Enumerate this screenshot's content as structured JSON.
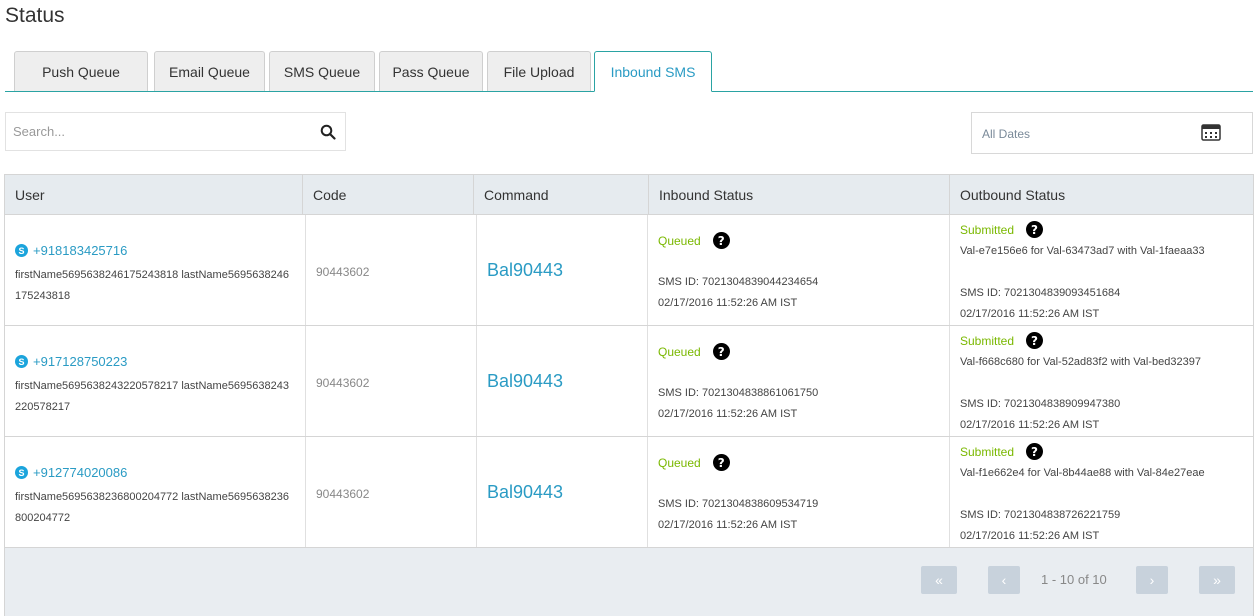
{
  "page": {
    "title": "Status"
  },
  "tabs": [
    {
      "label": "Push Queue"
    },
    {
      "label": "Email Queue"
    },
    {
      "label": "SMS Queue"
    },
    {
      "label": "Pass Queue"
    },
    {
      "label": "File Upload"
    },
    {
      "label": "Inbound SMS",
      "active": true
    }
  ],
  "search": {
    "placeholder": "Search...",
    "value": "",
    "icon": "search-icon"
  },
  "date_filter": {
    "label": "All Dates",
    "icon": "calendar-icon"
  },
  "table": {
    "columns": [
      "User",
      "Code",
      "Command",
      "Inbound Status",
      "Outbound Status"
    ],
    "rows": [
      {
        "phone": "+918183425716",
        "name": "firstName5695638246175243818 lastName5695638246175243818",
        "code": "90443602",
        "command": "Bal90443",
        "inbound_status": "Queued",
        "inbound_sms_id": "SMS ID: 7021304839044234654",
        "inbound_time": "02/17/2016 11:52:26 AM IST",
        "outbound_status": "Submitted",
        "outbound_detail": "Val-e7e156e6 for Val-63473ad7 with Val-1faeaa33",
        "outbound_sms_id": "SMS ID: 7021304839093451684",
        "outbound_time": "02/17/2016 11:52:26 AM IST"
      },
      {
        "phone": "+917128750223",
        "name": "firstName5695638243220578217 lastName5695638243220578217",
        "code": "90443602",
        "command": "Bal90443",
        "inbound_status": "Queued",
        "inbound_sms_id": "SMS ID: 7021304838861061750",
        "inbound_time": "02/17/2016 11:52:26 AM IST",
        "outbound_status": "Submitted",
        "outbound_detail": "Val-f668c680 for Val-52ad83f2 with Val-bed32397",
        "outbound_sms_id": "SMS ID: 7021304838909947380",
        "outbound_time": "02/17/2016 11:52:26 AM IST"
      },
      {
        "phone": "+912774020086",
        "name": "firstName5695638236800204772 lastName5695638236800204772",
        "code": "90443602",
        "command": "Bal90443",
        "inbound_status": "Queued",
        "inbound_sms_id": "SMS ID: 7021304838609534719",
        "inbound_time": "02/17/2016 11:52:26 AM IST",
        "outbound_status": "Submitted",
        "outbound_detail": "Val-f1e662e4 for Val-8b44ae88 with Val-84e27eae",
        "outbound_sms_id": "SMS ID: 7021304838726221759",
        "outbound_time": "02/17/2016 11:52:26 AM IST"
      }
    ]
  },
  "pagination": {
    "info": "1 - 10 of 10",
    "first_glyph": "«",
    "prev_glyph": "‹",
    "next_glyph": "›",
    "last_glyph": "»"
  },
  "colors": {
    "accent": "#2aa3a3",
    "link": "#2a9bc4",
    "status_green": "#7ab800"
  }
}
